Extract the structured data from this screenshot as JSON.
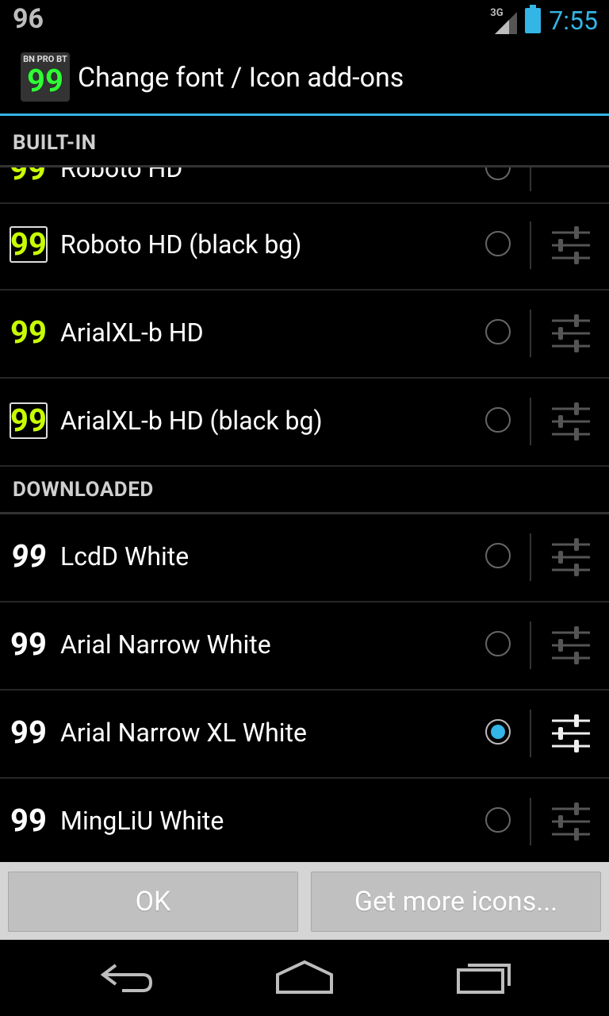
{
  "status_bar": {
    "notification_number": "96",
    "network": "3G",
    "time": "7:55"
  },
  "action_bar": {
    "icon_top": "BN PRO BT",
    "icon_number": "99",
    "title": "Change font / Icon add-ons"
  },
  "sections": [
    {
      "label": "BUILT-IN"
    },
    {
      "label": "DOWNLOADED"
    }
  ],
  "partial_row_text": "Roboto HD",
  "rows": [
    {
      "badge": "99",
      "name": "Roboto HD (black bg)",
      "style": "green-bg",
      "selected": false
    },
    {
      "badge": "99",
      "name": "ArialXL-b HD",
      "style": "green",
      "selected": false
    },
    {
      "badge": "99",
      "name": "ArialXL-b HD (black bg)",
      "style": "green-bg",
      "selected": false
    },
    {
      "badge": "99",
      "name": "LcdD White",
      "style": "white",
      "selected": false
    },
    {
      "badge": "99",
      "name": "Arial Narrow White",
      "style": "white",
      "selected": false
    },
    {
      "badge": "99",
      "name": "Arial Narrow XL White",
      "style": "white",
      "selected": true
    },
    {
      "badge": "99",
      "name": "MingLiU White",
      "style": "white",
      "selected": false
    }
  ],
  "buttons": {
    "ok": "OK",
    "get_more": "Get more icons..."
  },
  "colors": {
    "accent": "#33b5e5",
    "green_icon": "#c8ff00"
  }
}
